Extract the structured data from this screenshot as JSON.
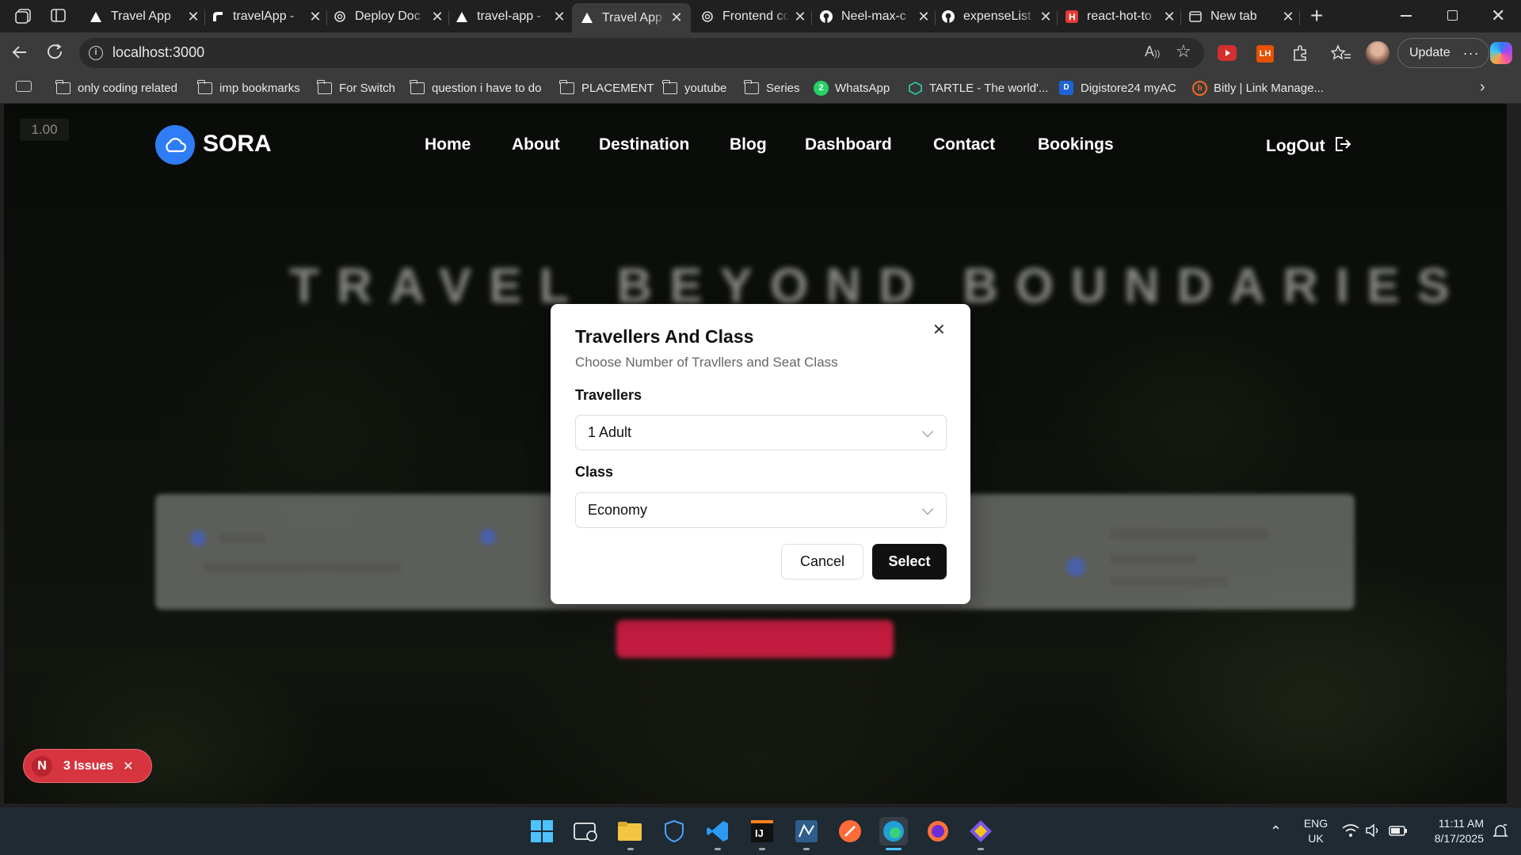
{
  "browser": {
    "tabs": [
      {
        "label": "Travel App",
        "icon": "vercel-triangle-icon"
      },
      {
        "label": "travelApp - ",
        "icon": "render-icon"
      },
      {
        "label": "Deploy Doc",
        "icon": "openai-icon"
      },
      {
        "label": "travel-app - ",
        "icon": "vercel-triangle-icon"
      },
      {
        "label": "Travel App",
        "icon": "vercel-triangle-icon",
        "active": true
      },
      {
        "label": "Frontend cc",
        "icon": "openai-icon"
      },
      {
        "label": "Neel-max-c",
        "icon": "github-icon"
      },
      {
        "label": "expenseList",
        "icon": "github-icon"
      },
      {
        "label": "react-hot-to",
        "icon": "h-icon"
      },
      {
        "label": "New tab",
        "icon": "newtab-icon"
      }
    ],
    "url": "localhost:3000",
    "update_label": "Update",
    "bookmarks": [
      {
        "label": "only coding  related",
        "icon": "folder-icon"
      },
      {
        "label": "imp bookmarks",
        "icon": "folder-icon"
      },
      {
        "label": "For Switch",
        "icon": "folder-icon"
      },
      {
        "label": "question i have to do",
        "icon": "folder-icon"
      },
      {
        "label": "PLACEMENT",
        "icon": "folder-icon"
      },
      {
        "label": "youtube",
        "icon": "folder-icon"
      },
      {
        "label": "Series",
        "icon": "folder-icon"
      },
      {
        "label": "WhatsApp",
        "icon": "whatsapp-icon"
      },
      {
        "label": "TARTLE - The world'...",
        "icon": "tartle-icon"
      },
      {
        "label": "Digistore24 myAC",
        "icon": "digistore-icon"
      },
      {
        "label": "Bitly | Link Manage...",
        "icon": "bitly-icon"
      }
    ]
  },
  "page": {
    "zoom_badge": "1.00",
    "brand": "SORA",
    "nav": [
      "Home",
      "About",
      "Destination",
      "Blog",
      "Dashboard",
      "Contact",
      "Bookings"
    ],
    "logout_label": "LogOut",
    "hero_title": "TRAVEL BEYOND BOUNDARIES",
    "issues_badge": {
      "letter": "N",
      "label": "3 Issues"
    }
  },
  "modal": {
    "title": "Travellers And Class",
    "subtitle": "Choose Number of Travllers and Seat Class",
    "travellers_label": "Travellers",
    "travellers_value": "1 Adult",
    "class_label": "Class",
    "class_value": "Economy",
    "cancel_label": "Cancel",
    "select_label": "Select"
  },
  "taskbar": {
    "language": "ENG",
    "region": "UK",
    "time": "11:11 AM",
    "date": "8/17/2025"
  },
  "colors": {
    "brand_blue": "#2f7df6",
    "accent_red": "#e11d48",
    "select_button": "#111111",
    "issues_red": "#d6343f"
  }
}
